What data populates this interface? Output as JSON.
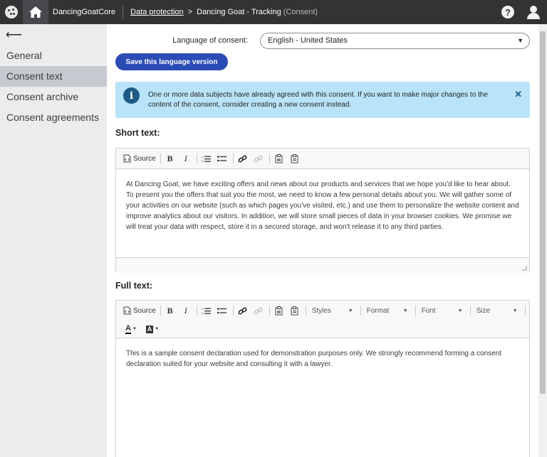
{
  "topbar": {
    "site_name": "DancingGoatCore",
    "breadcrumb_link": "Data protection",
    "breadcrumb_separator": ">",
    "breadcrumb_current": "Dancing Goat - Tracking",
    "breadcrumb_type": "(Consent)",
    "help_label": "?"
  },
  "sidebar": {
    "back_glyph": "⟵",
    "items": [
      {
        "label": "General"
      },
      {
        "label": "Consent text"
      },
      {
        "label": "Consent archive"
      },
      {
        "label": "Consent agreements"
      }
    ],
    "active_index": 1
  },
  "main": {
    "language_label": "Language of consent:",
    "language_value": "English - United States",
    "save_button": "Save this language version",
    "alert_text": "One or more data subjects have already agreed with this consent. If you want to make major changes to the content of the consent, consider creating a new consent instead.",
    "short_text_title": "Short text:",
    "full_text_title": "Full text:",
    "source_label": "Source",
    "combos": [
      "Styles",
      "Format",
      "Font",
      "Size"
    ],
    "short_text": "At Dancing Goat, we have exciting offers and news about our products and services that we hope you'd like to hear about. To present you the offers that suit you the most, we need to know a few personal details about you. We will gather some of your activities on our website (such as which pages you've visited, etc.) and use them to personalize the website content and improve analytics about our visitors. In addition, we will store small pieces of data in your browser cookies. We promise we will treat your data with respect, store it in a secured storage, and won't release it to any third parties.",
    "full_text": "This is a sample consent declaration used for demonstration purposes only. We strongly recommend forming a consent declaration suited for your website and consulting it with a lawyer."
  },
  "colors": {
    "topbar": "#333336",
    "sidebar": "#ececee",
    "sidebar_active": "#c7c9d1",
    "primary_button": "#2b4cb5",
    "alert_bg": "#b8e3f8",
    "alert_icon": "#1d5a86"
  },
  "icons": [
    "app-menu-icon",
    "home-icon",
    "help-icon",
    "user-icon",
    "back-arrow-icon",
    "info-icon",
    "close-icon",
    "chevron-down-icon"
  ]
}
